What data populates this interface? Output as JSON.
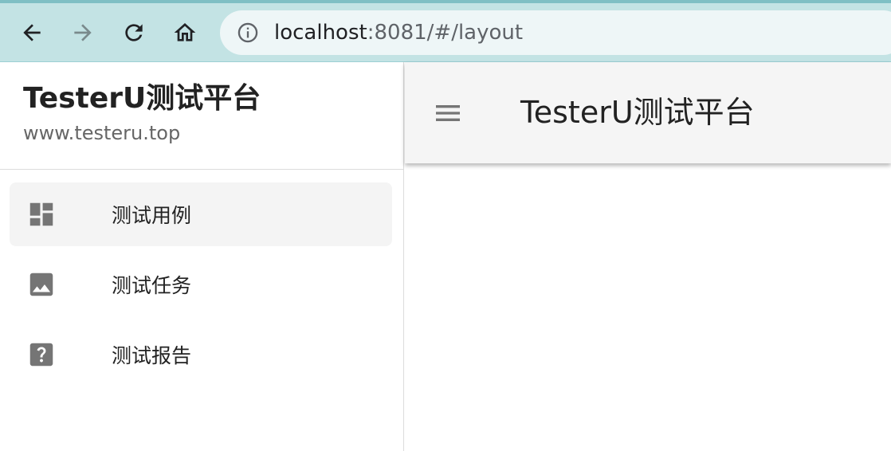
{
  "browser": {
    "back_icon": "arrow-left-icon",
    "forward_icon": "arrow-right-icon",
    "reload_icon": "reload-icon",
    "home_icon": "home-icon",
    "info_icon": "info-icon",
    "url_host": "localhost",
    "url_rest": ":8081/#/layout"
  },
  "sidebar": {
    "title": "TesterU测试平台",
    "subtitle": "www.testeru.top",
    "items": [
      {
        "label": "测试用例",
        "icon": "dashboard-icon",
        "active": true
      },
      {
        "label": "测试任务",
        "icon": "image-icon",
        "active": false
      },
      {
        "label": "测试报告",
        "icon": "help-icon",
        "active": false
      }
    ]
  },
  "toolbar": {
    "menu_icon": "hamburger-menu-icon",
    "title": "TesterU测试平台"
  },
  "colors": {
    "browser_bar": "#c3e3e4",
    "url_box": "#eef6f7",
    "toolbar_bg": "#f5f5f5",
    "active_item_bg": "#f4f4f4",
    "icon_grey": "#757575"
  }
}
